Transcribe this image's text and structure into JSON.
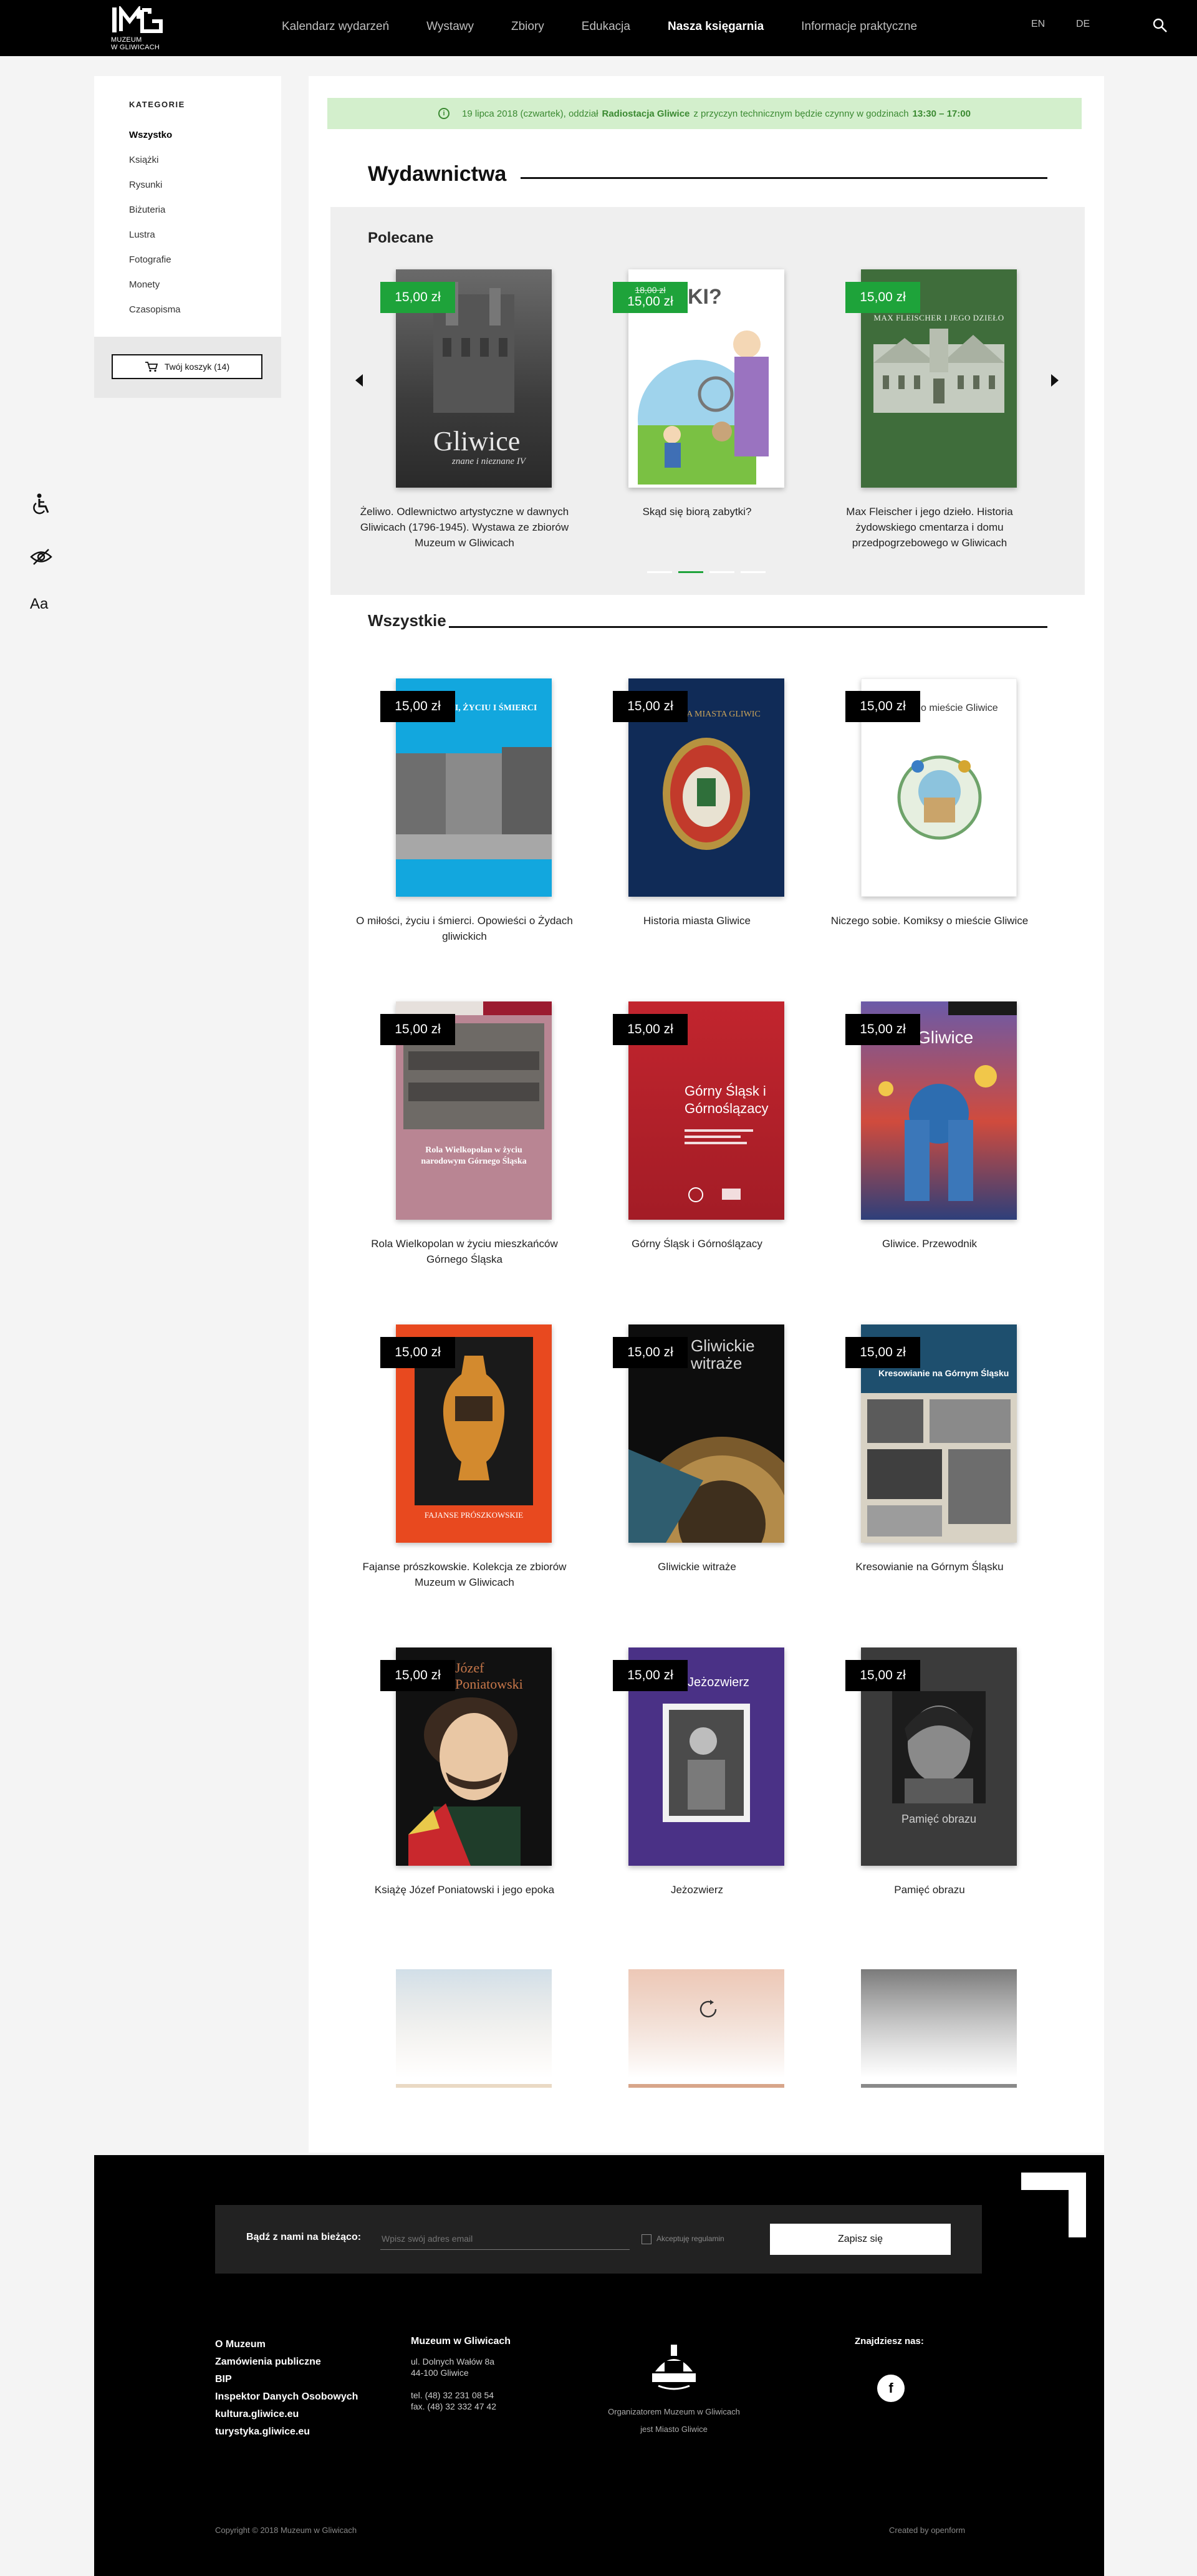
{
  "header": {
    "logo_lines": [
      "MUZEUM",
      "W GLIWICACH"
    ],
    "nav": [
      "Kalendarz wydarzeń",
      "Wystawy",
      "Zbiory",
      "Edukacja",
      "Nasza księgarnia",
      "Informacje praktyczne"
    ],
    "active_nav": "Nasza księgarnia",
    "lang": [
      "EN",
      "DE"
    ]
  },
  "sidebar": {
    "title": "KATEGORIE",
    "items": [
      "Wszystko",
      "Książki",
      "Rysunki",
      "Biżuteria",
      "Lustra",
      "Fotografie",
      "Monety",
      "Czasopisma"
    ],
    "active": "Wszystko",
    "cart_label": "Twój koszyk (14)"
  },
  "notice": {
    "pre": "19 lipca 2018 (czwartek), oddział ",
    "bold": "Radiostacja Gliwice",
    "mid": " z przyczyn technicznym będzie czynny w godzinach ",
    "hours": "13:30 – 17:00"
  },
  "page": {
    "title": "Wydawnictwa",
    "featured_title": "Polecane",
    "all_title": "Wszystkie"
  },
  "featured": [
    {
      "price": "15,00 zł",
      "old": "",
      "title": "Żeliwo. Odlewnictwo artystyczne w dawnych Gliwicach (1796-1945). Wystawa ze zbiorów Muzeum w Gliwicach",
      "cover_text": "Gliwice",
      "cover_sub": "znane i nieznane IV"
    },
    {
      "price": "15,00 zł",
      "old": "18,00 zł",
      "title": "Skąd się biorą zabytki?",
      "cover_text": "KI?",
      "cover_sub": ""
    },
    {
      "price": "15,00 zł",
      "old": "",
      "title": "Max Fleischer i jego dzieło. Historia żydowskiego cmentarza i domu przedpogrzebowego w Gliwicach",
      "cover_text": "MAX FLEISCHER I JEGO DZIEŁO",
      "cover_sub": ""
    }
  ],
  "products": [
    {
      "price": "15,00 zł",
      "title": "O miłości, życiu i śmierci. Opowieści o Żydach gliwickich",
      "cover_text": "O MIŁOŚCI, ŻYCIU I ŚMIERCI"
    },
    {
      "price": "15,00 zł",
      "title": "Historia miasta Gliwice",
      "cover_text": "HISTORIA MIASTA GLIWIC"
    },
    {
      "price": "15,00 zł",
      "title": "Niczego sobie. Komiksy o mieście Gliwice",
      "cover_text": "o mieście Gliwice"
    },
    {
      "price": "15,00 zł",
      "title": "Rola Wielkopolan w życiu mieszkańców Górnego Śląska",
      "cover_text": "Rola Wielkopolan w życiu narodowym Górnego Śląska"
    },
    {
      "price": "15,00 zł",
      "title": "Górny Śląsk i Górnoślązacy",
      "cover_text": "Górny Śląsk i Górnoślązacy"
    },
    {
      "price": "15,00 zł",
      "title": "Gliwice. Przewodnik",
      "cover_text": "Gliwice"
    },
    {
      "price": "15,00 zł",
      "title": "Fajanse prószkowskie. Kolekcja ze zbiorów Muzeum w Gliwicach",
      "cover_text": "FAJANSE PRÓSZKOWSKIE"
    },
    {
      "price": "15,00 zł",
      "title": "Gliwickie witraże",
      "cover_text": "Gliwickie witraże"
    },
    {
      "price": "15,00 zł",
      "title": "Kresowianie na Górnym Śląsku",
      "cover_text": "Kresowianie na Górnym Śląsku"
    },
    {
      "price": "15,00 zł",
      "title": "Książę Józef Poniatowski i jego epoka",
      "cover_text": "Józef Poniatowski"
    },
    {
      "price": "15,00 zł",
      "title": "Jeżozwierz",
      "cover_text": "Jeżozwierz"
    },
    {
      "price": "15,00 zł",
      "title": "Pamięć obrazu",
      "cover_text": "Pamięć obrazu"
    }
  ],
  "footer": {
    "newsletter_label": "Bądź z nami na bieżąco:",
    "email_placeholder": "Wpisz swój adres email",
    "accept_label": "Akceptuję regulamin",
    "subscribe": "Zapisz się",
    "links": [
      "O Muzeum",
      "Zamówienia publiczne",
      "BIP",
      "Inspektor Danych Osobowych",
      "kultura.gliwice.eu",
      "turystyka.gliwice.eu"
    ],
    "addr_title": "Muzeum w Gliwicach",
    "addr_lines": [
      "ul. Dolnych Wałów 8a",
      "44-100 Gliwice",
      "",
      "tel. (48) 32 231 08 54",
      "fax. (48) 32 332 47 42"
    ],
    "org_line1": "Organizatorem Muzeum w Gliwicach",
    "org_line2": "jest Miasto Gliwice",
    "social_title": "Znajdziesz nas:",
    "copyright": "Copyright © 2018 Muzeum w Gliwicach",
    "created_by": "Created by openform"
  }
}
